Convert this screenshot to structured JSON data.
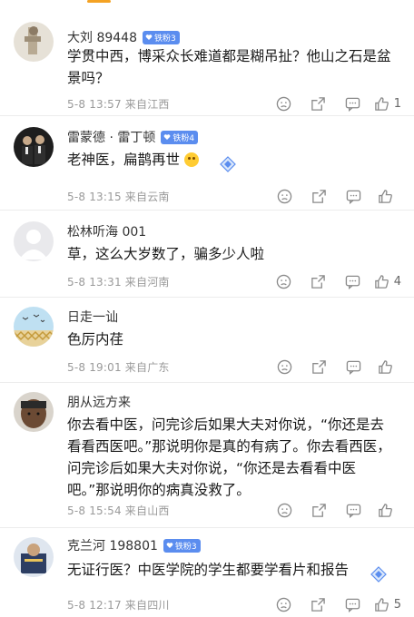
{
  "comments": [
    {
      "name": "大刘 89448",
      "badge": "铁粉3",
      "text": "学贯中西，博采众长难道都是糊吊扯？他山之石是盆景吗？",
      "meta": "5-8 13:57 来自江西",
      "likes": "1"
    },
    {
      "name": "雷蒙德 · 雷丁顿",
      "badge": "铁粉4",
      "text": "老神医，扁鹊再世",
      "meta": "5-8 13:15 来自云南",
      "likes": ""
    },
    {
      "name": "松林听海 001",
      "badge": "",
      "text": "草，这么大岁数了，骗多少人啦",
      "meta": "5-8 13:31 来自河南",
      "likes": "4"
    },
    {
      "name": "日走一讪",
      "badge": "",
      "text": "色厉内荏",
      "meta": "5-8 19:01 来自广东",
      "likes": ""
    },
    {
      "name": "朋从远方来",
      "badge": "",
      "text": "你去看中医，问完诊后如果大夫对你说，“你还是去看看西医吧。”那说明你是真的有病了。你去看西医，问完诊后如果大夫对你说，“你还是去看看中医吧。”那说明你的病真没救了。",
      "meta": "5-8 15:54 来自山西",
      "likes": ""
    },
    {
      "name": "克兰河 198801",
      "badge": "铁粉3",
      "text": "无证行医？中医学院的学生都要学看片和报告",
      "meta": "5-8 12:17 来自四川",
      "likes": "5"
    }
  ],
  "colors": {
    "badge": "#5b8def",
    "meta": "#9a9a9a",
    "accent": "#f4a223"
  }
}
